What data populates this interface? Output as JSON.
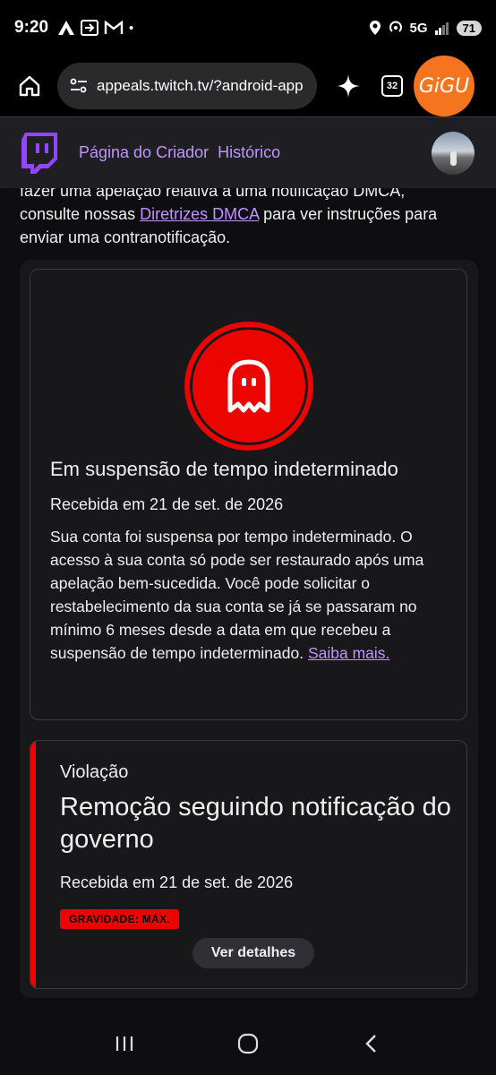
{
  "status_bar": {
    "time": "9:20",
    "network": "5G",
    "battery": "71"
  },
  "browser": {
    "url": "appeals.twitch.tv/?android-app",
    "tab_count": "32",
    "profile_label": "GiGU"
  },
  "header": {
    "nav_creator": "Página do Criador",
    "nav_history": "Histórico"
  },
  "intro": {
    "text_before": "fazer uma apelação relativa a uma notificação DMCA, consulte nossas ",
    "link": "Diretrizes DMCA",
    "text_after": " para ver instruções para enviar uma contranotificação."
  },
  "suspension": {
    "title": "Em suspensão de tempo indeterminado",
    "date": "Recebida em 21 de set. de 2026",
    "body": "Sua conta foi suspensa por tempo indeterminado. O acesso à sua conta só pode ser restaurado após uma apelação bem-sucedida. Você pode solicitar o restabelecimento da sua conta se já se passaram no mínimo 6 meses desde a data em que recebeu a suspensão de tempo indeterminado. ",
    "learn_more": "Saiba mais."
  },
  "violation": {
    "label": "Violação",
    "title": "Remoção seguindo notificação do governo",
    "date": "Recebida em 21 de set. de 2026",
    "severity": "GRAVIDADE: MÁX.",
    "details_button": "Ver detalhes"
  },
  "colors": {
    "accent": "#bf94ff",
    "danger": "#eb0400",
    "twitch": "#9146ff"
  }
}
